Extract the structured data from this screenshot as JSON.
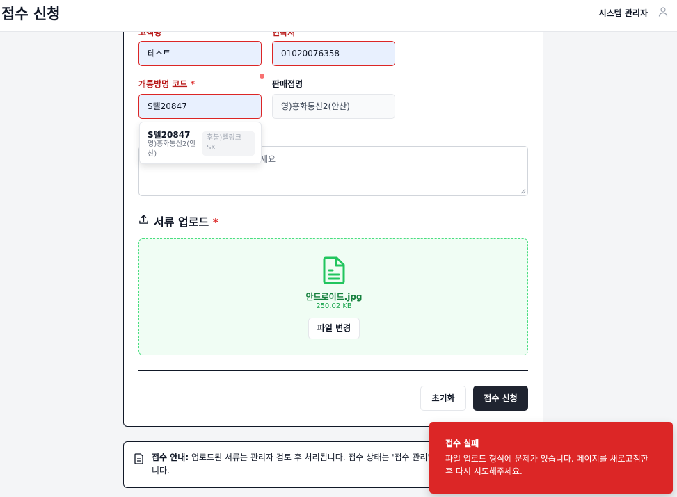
{
  "header": {
    "title": "접수 신청",
    "user_name": "시스템 관리자",
    "user_icon": "user-icon"
  },
  "form": {
    "customer_label": "고객명",
    "customer_value": "테스트",
    "contact_label": "연락처",
    "contact_value": "01020076358",
    "code_label": "개통방명 코드",
    "code_required": "*",
    "code_value": "S텔20847",
    "store_label": "판매점명",
    "store_value": "영)흥화통신2(안산)",
    "memo_placeholder_visible": "세요"
  },
  "autocomplete": {
    "items": [
      {
        "code": "S텔20847",
        "store": "영)흥화통신2(안산)",
        "tag": "후불)텔링크 SK"
      }
    ]
  },
  "upload": {
    "section_title": "서류 업로드",
    "required_mark": "*",
    "file_name": "안드로이드.jpg",
    "file_size": "250.02 KB",
    "change_label": "파일 변경"
  },
  "actions": {
    "reset_label": "초기화",
    "submit_label": "접수 신청"
  },
  "notice": {
    "bold": "접수 안내:",
    "text": " 업로드된 서류는 관리자 검토 후 처리됩니다. 접수 상태는 '접수 관리' 메뉴에서 확인하실 수 있습니다."
  },
  "toast": {
    "title": "접수 실패",
    "message": "파일 업로드 형식에 문제가 있습니다. 페이지를 새로고침한 후 다시 시도해주세요."
  },
  "colors": {
    "error": "#dc2626",
    "success": "#22c55e",
    "primary_button": "#1f2430",
    "autofill_bg": "#e8f0fe"
  }
}
